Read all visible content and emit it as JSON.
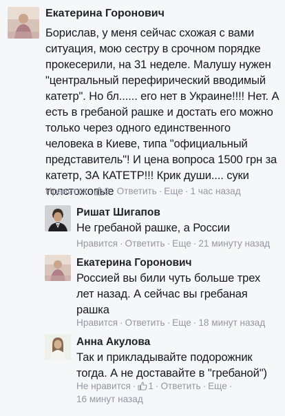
{
  "comments": [
    {
      "author": "Екатерина Горонович",
      "text_lines": [
        "Борислав, у меня сейчас схожая с вами",
        "ситуация, мою сестру в срочном порядке",
        "прокесерили, на 31 неделе. Малушу нужен",
        "\"центральный перефирический вводимый",
        "катетр\". Но бл...... его нет в Украине!!!! Нет. А",
        "есть в гребаной рашке и достать его можно",
        "только через одного единственного",
        "человека в Киеве, типа \"официальный",
        "представитель\"! И цена вопроса 1500 грн за",
        "катетр, ЗА КАТЕТР!!! Крик души.... суки",
        "толстожопые"
      ],
      "like_label": "Нравится",
      "like_count": "9",
      "reply_label": "Ответить",
      "more_label": "Еще",
      "time": "1 час назад"
    },
    {
      "author": "Ришат Шигапов",
      "text": "Не гребаной рашке, а России",
      "like_label": "Нравится",
      "reply_label": "Ответить",
      "more_label": "Еще",
      "time": "21 минуту назад"
    },
    {
      "author": "Екатерина Горонович",
      "text_lines": [
        "Россией вы били чуть больше трех",
        "лет назад. А сейчас вы гребаная",
        "рашка"
      ],
      "like_label": "Нравится",
      "reply_label": "Ответить",
      "more_label": "Еще",
      "time": "18 минут назад"
    },
    {
      "author": "Анна Акулова",
      "text_lines": [
        "Так и прикладывайте подорожник",
        "тогда. А не доставайте в \"гребаной\")"
      ],
      "like_label": "Не нравится",
      "like_count": "1",
      "reply_label": "Ответить",
      "more_label": "Еще",
      "time": "16 минут назад"
    }
  ],
  "colors": {
    "background": "#f6f7f9",
    "text": "#141823",
    "meta": "#9197a3"
  },
  "icons": {
    "like": "thumbs-up-icon"
  }
}
